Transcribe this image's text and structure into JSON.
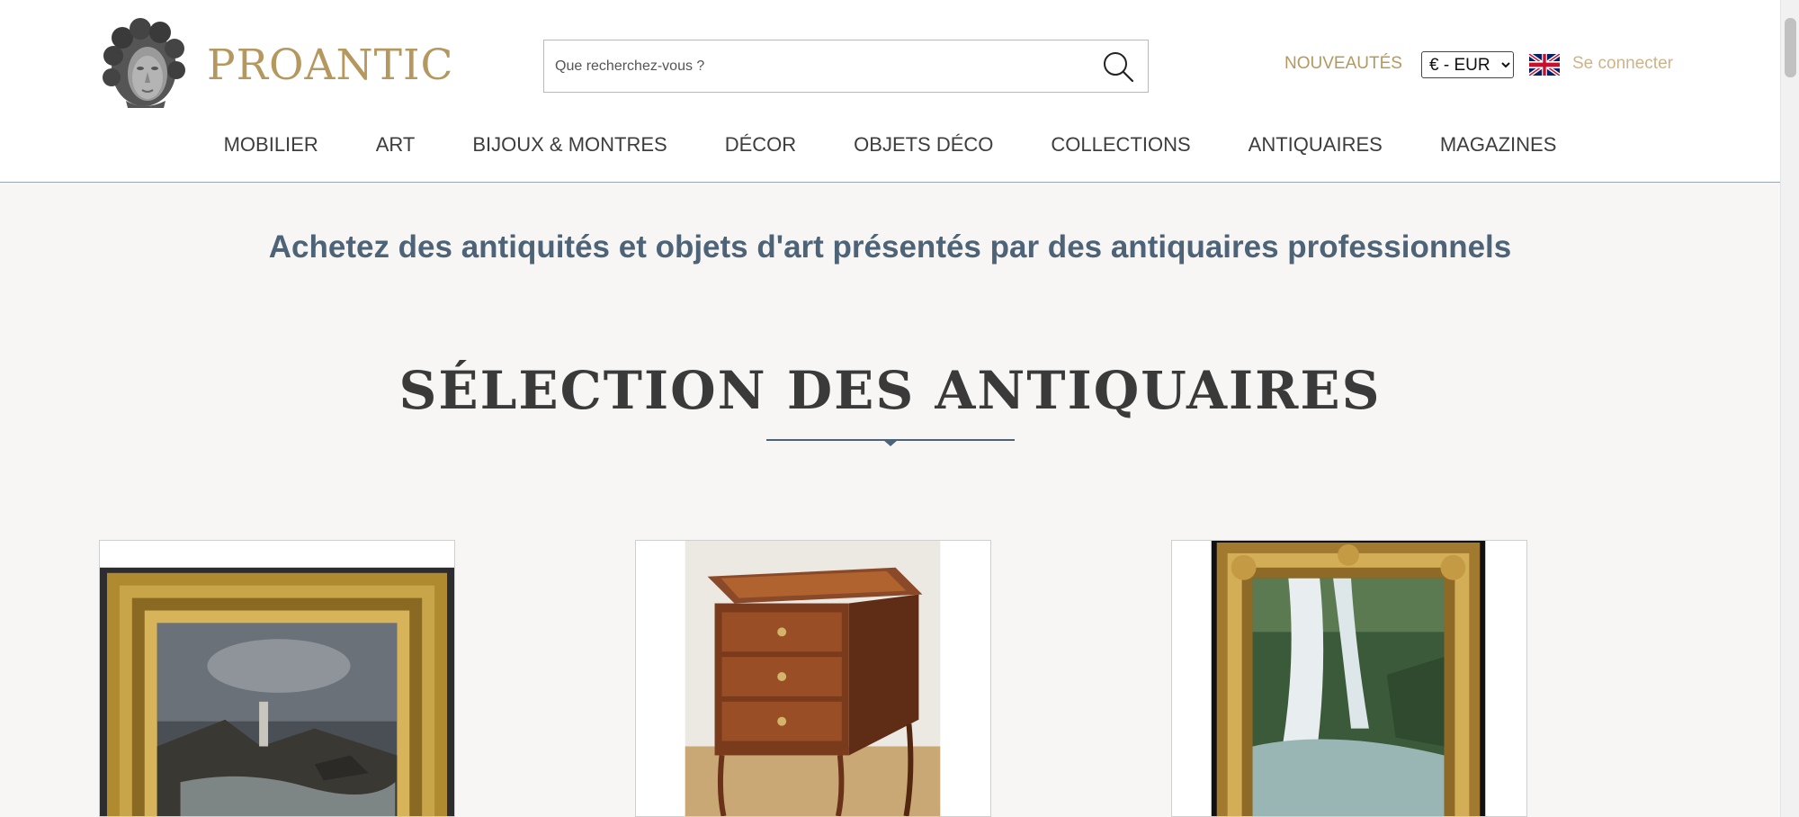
{
  "brand": {
    "name": "PROANTIC",
    "logo_icon": "classical-head-logo"
  },
  "search": {
    "placeholder": "Que recherchez-vous ?",
    "value": "",
    "icon": "search-icon"
  },
  "header": {
    "nouveautes": "NOUVEAUTÉS",
    "currency": {
      "selected": "€ - EUR",
      "options": [
        "€ - EUR"
      ]
    },
    "language_icon": "uk-flag-icon",
    "login": "Se connecter"
  },
  "nav": {
    "items": [
      {
        "label": "MOBILIER"
      },
      {
        "label": "ART"
      },
      {
        "label": "BIJOUX & MONTRES"
      },
      {
        "label": "DÉCOR"
      },
      {
        "label": "OBJETS DÉCO"
      },
      {
        "label": "COLLECTIONS"
      },
      {
        "label": "ANTIQUAIRES"
      },
      {
        "label": "MAGAZINES"
      }
    ]
  },
  "main": {
    "tagline": "Achetez des antiquités et objets d'art présentés par des antiquaires professionnels",
    "section_title": "SÉLECTION DES ANTIQUAIRES",
    "cards": [
      {
        "image": "gilt-framed-seascape-painting"
      },
      {
        "image": "marquetry-chest-of-drawers"
      },
      {
        "image": "gilt-framed-waterfall-painting"
      }
    ]
  },
  "colors": {
    "brand_gold": "#b5985f",
    "login_gold": "#cdb38a",
    "tagline_blue": "#4d6378",
    "divider_blue": "#4d6378",
    "background": "#f7f6f4"
  }
}
